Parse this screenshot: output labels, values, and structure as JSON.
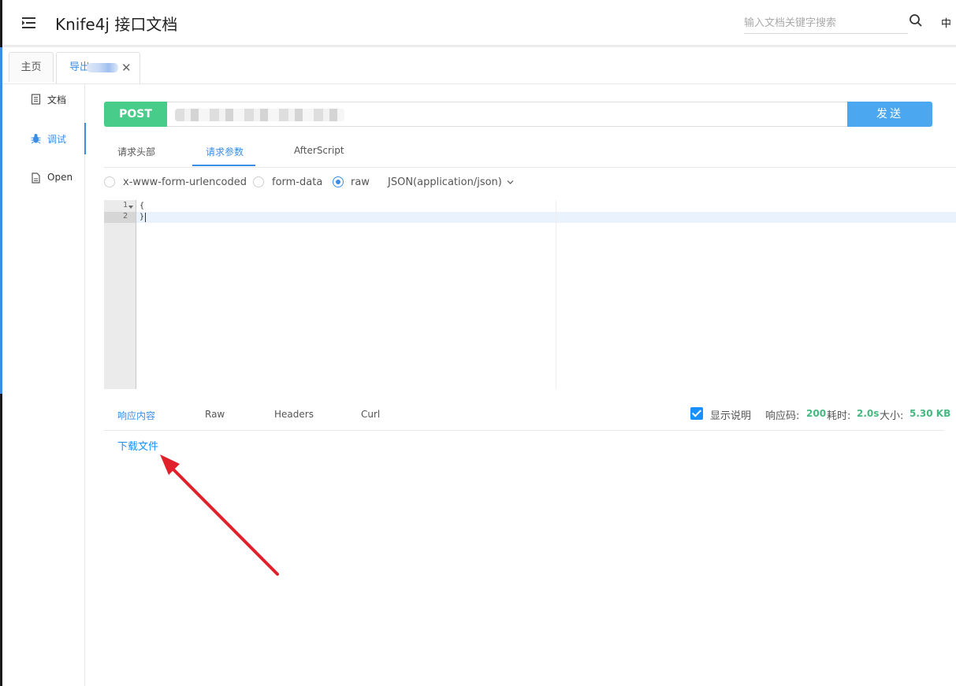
{
  "header": {
    "title": "Knife4j 接口文档",
    "search_placeholder": "输入文档关键字搜索",
    "lang": "中"
  },
  "tabs": [
    {
      "label": "主页"
    },
    {
      "label": "导出"
    }
  ],
  "sidebar": {
    "items": [
      {
        "label": "文档",
        "icon": "document-icon"
      },
      {
        "label": "调试",
        "icon": "bug-icon",
        "active": true
      },
      {
        "label": "Open",
        "icon": "file-icon"
      }
    ]
  },
  "request": {
    "method": "POST",
    "send_label": "发送",
    "tabs": [
      "请求头部",
      "请求参数",
      "AfterScript"
    ],
    "active_tab": "请求参数",
    "body_types": [
      "x-www-form-urlencoded",
      "form-data",
      "raw"
    ],
    "selected_body_type": "raw",
    "content_type": "JSON(application/json)",
    "editor": {
      "line_numbers": [
        "1",
        "2"
      ],
      "lines": [
        "{",
        "}"
      ]
    }
  },
  "response": {
    "tabs": [
      "响应内容",
      "Raw",
      "Headers",
      "Curl"
    ],
    "active_tab": "响应内容",
    "show_desc_label": "显示说明",
    "show_desc_checked": true,
    "code_label": "响应码:",
    "code_value": "200",
    "time_label": "耗时:",
    "time_value": "2.0s",
    "size_label": "大小:",
    "size_value": "5.30 KB",
    "download_label": "下载文件"
  },
  "colors": {
    "accent": "#3a8ee6",
    "method_post": "#47cc8a",
    "send_button": "#4ba8f0",
    "success_value": "#47b881",
    "annotation_arrow": "#e0202a"
  }
}
